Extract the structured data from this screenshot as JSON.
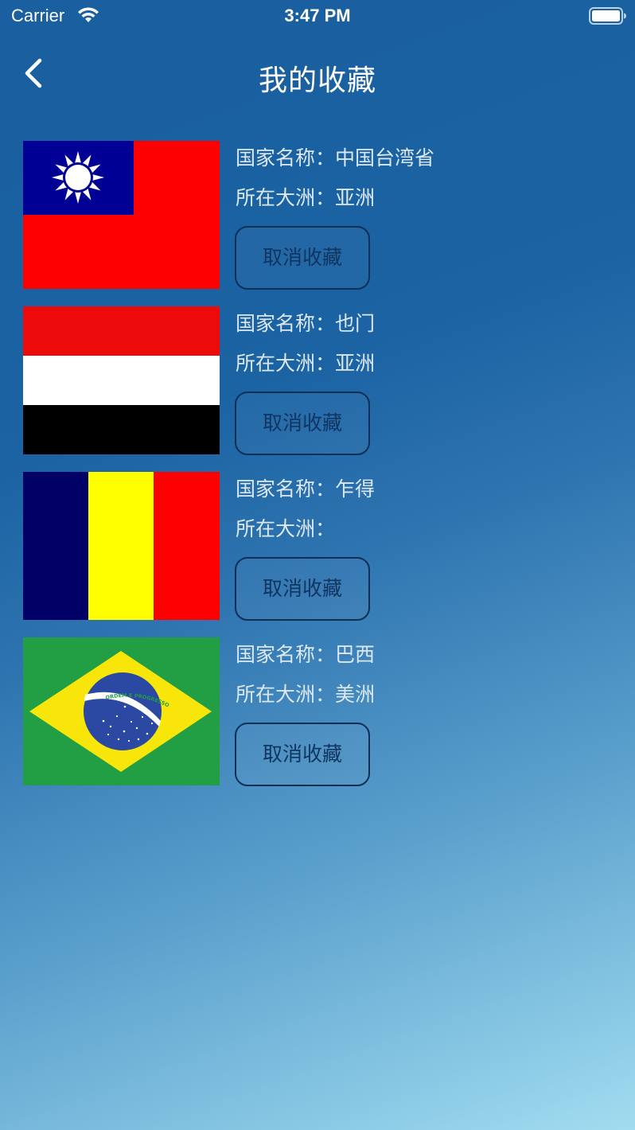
{
  "status_bar": {
    "carrier": "Carrier",
    "time": "3:47 PM",
    "wifi_icon": "wifi-icon",
    "battery_icon": "battery-icon"
  },
  "nav": {
    "back_icon": "chevron-left-icon",
    "title": "我的收藏"
  },
  "favorites": [
    {
      "country_label": "国家名称：",
      "country": "中国台湾省",
      "continent_label": "所在大洲：",
      "continent": "亚洲",
      "button": "取消收藏",
      "flag": "taiwan-flag"
    },
    {
      "country_label": "国家名称：",
      "country": "也门",
      "continent_label": "所在大洲：",
      "continent": "亚洲",
      "button": "取消收藏",
      "flag": "yemen-flag"
    },
    {
      "country_label": "国家名称：",
      "country": "乍得",
      "continent_label": "所在大洲：",
      "continent": "",
      "button": "取消收藏",
      "flag": "chad-flag"
    },
    {
      "country_label": "国家名称：",
      "country": "巴西",
      "continent_label": "所在大洲：",
      "continent": "美洲",
      "button": "取消收藏",
      "flag": "brazil-flag",
      "flag_banner_text": "ORDEM E PROGRESSO"
    }
  ],
  "colors": {
    "background_top": "#1a5fa0",
    "background_bottom": "#a2dcf0",
    "button_border": "#0d2f55",
    "label_text": "#dbe8f3"
  }
}
